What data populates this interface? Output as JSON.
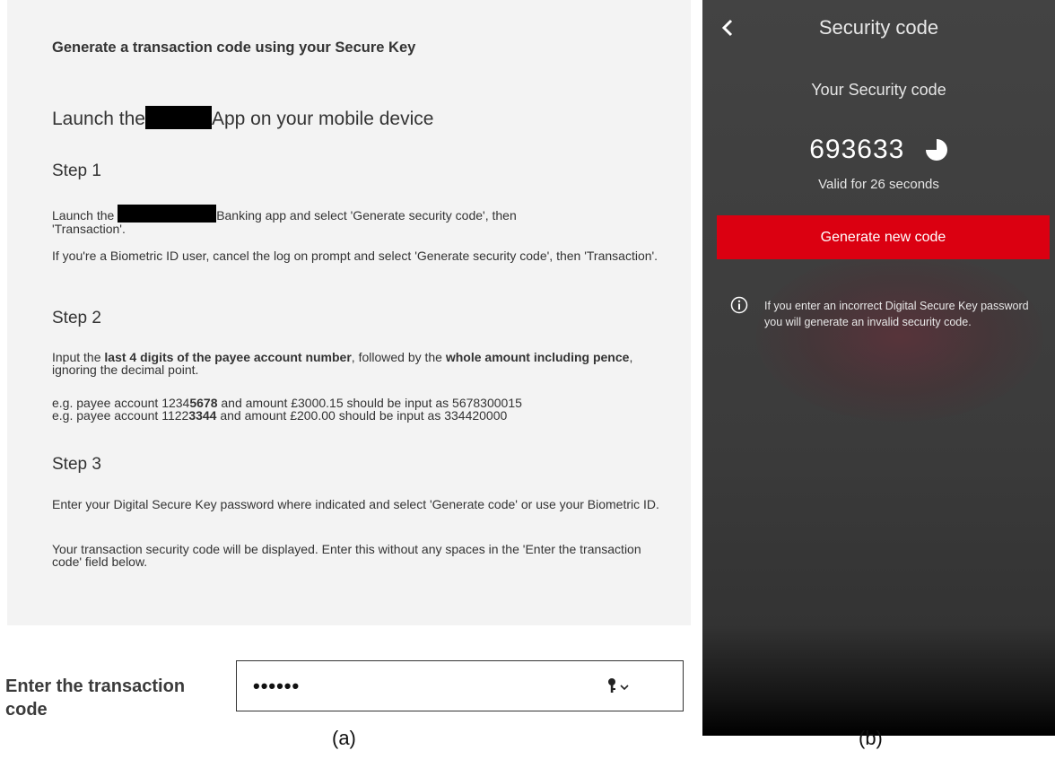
{
  "panel_a": {
    "heading": "Generate a transaction code using your Secure Key",
    "launch": {
      "before": "Launch the",
      "after": "App on your mobile device"
    },
    "step1": {
      "title": "Step 1",
      "line1_before": "Launch the",
      "line1_after": "Banking app and select 'Generate security code', then",
      "line1_cont": "'Transaction'.",
      "para2": "If you're a Biometric ID user, cancel the log on prompt and select 'Generate security code', then 'Transaction'."
    },
    "step2": {
      "title": "Step 2",
      "p_input": "Input the ",
      "p_bold1": "last 4 digits of the payee account number",
      "p_mid": ", followed by the ",
      "p_bold2": "whole amount including pence",
      "p_end": ", ignoring the decimal point.",
      "ex1_pre": "e.g. payee account 1234",
      "ex1_bold": "5678",
      "ex1_post": " and amount £3000.15 should be input as 5678300015",
      "ex2_pre": "e.g. payee account 1122",
      "ex2_bold": "3344",
      "ex2_post": " and amount £200.00 should be input as 334420000"
    },
    "step3": {
      "title": "Step 3",
      "para1": "Enter your Digital Secure Key password where indicated and select 'Generate code' or use your Biometric ID.",
      "para2": "Your transaction security code will be displayed. Enter this without any spaces in the 'Enter the transaction code' field below."
    },
    "code_field": {
      "label": "Enter the transaction code",
      "value": "••••••",
      "icon": "key-dropdown-icon"
    },
    "caption": "(a)"
  },
  "panel_b": {
    "title": "Security code",
    "subtitle": "Your Security code",
    "code": "693633",
    "valid_text": "Valid for 26 seconds",
    "timer_remaining_fraction": 0.75,
    "button": "Generate new code",
    "info_text": "If you enter an incorrect Digital Secure Key password you will generate an invalid security code.",
    "caption": "(b)",
    "accent_color": "#db0011"
  }
}
